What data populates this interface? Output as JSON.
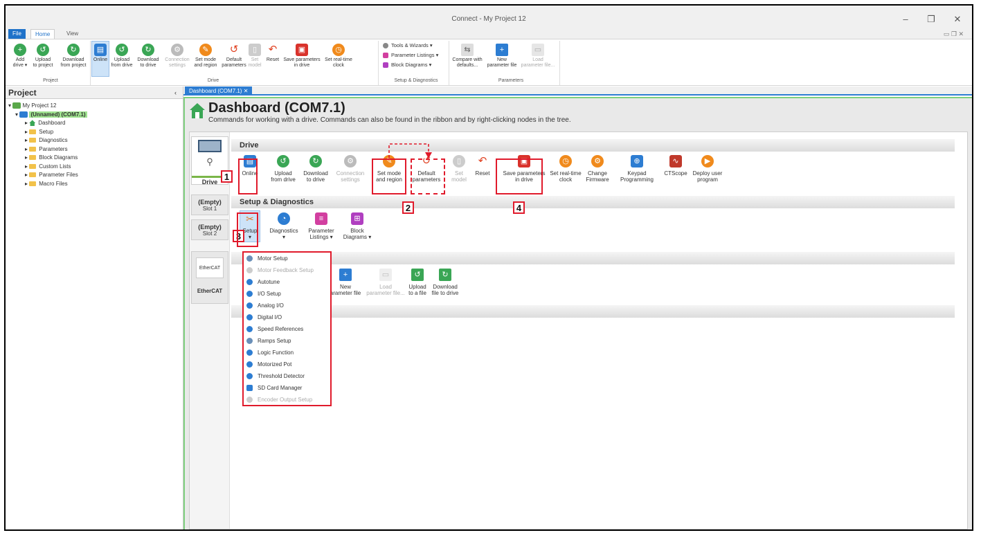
{
  "window": {
    "title": "Connect - My Project 12"
  },
  "menu_tabs": {
    "file": "File",
    "home": "Home",
    "view": "View"
  },
  "ribbon": {
    "project": {
      "add": [
        "Add",
        "drive ▾"
      ],
      "upload": [
        "Upload",
        "to project"
      ],
      "download": [
        "Download",
        "from project"
      ],
      "group": "Project"
    },
    "drive": {
      "online": [
        "Online",
        ""
      ],
      "upload": [
        "Upload",
        "from drive"
      ],
      "download": [
        "Download",
        "to drive"
      ],
      "connection": [
        "Connection",
        "settings"
      ],
      "setmode": [
        "Set mode",
        "and region"
      ],
      "default": [
        "Default",
        "parameters"
      ],
      "setmodel": [
        "Set",
        "model"
      ],
      "reset": [
        "Reset",
        ""
      ],
      "save": [
        "Save parameters",
        "in drive"
      ],
      "clock": [
        "Set real-time",
        "clock"
      ],
      "group": "Drive"
    },
    "setup_diag": {
      "tools": "Tools & Wizards",
      "listings": "Parameter Listings",
      "blocks": "Block Diagrams",
      "group": "Setup & Diagnostics"
    },
    "parameters": {
      "compare": [
        "Compare with",
        "defaults..."
      ],
      "new": [
        "New",
        "parameter file"
      ],
      "load": [
        "Load",
        "parameter file..."
      ],
      "group": "Parameters"
    }
  },
  "sidebar": {
    "header": "Project",
    "root": "My Project 12",
    "drive": "(Unnamed) (COM7.1)",
    "items": [
      "Dashboard",
      "Setup",
      "Diagnostics",
      "Parameters",
      "Block Diagrams",
      "Custom Lists",
      "Parameter Files",
      "Macro Files"
    ]
  },
  "doc_tab": "Dashboard (COM7.1)",
  "dashboard": {
    "title": "Dashboard (COM7.1)",
    "subtitle": "Commands for working with a drive. Commands can also be found in the ribbon and by right-clicking nodes in the tree.",
    "left": {
      "drive": "Drive",
      "slot1": [
        "(Empty)",
        "Slot 1"
      ],
      "slot2": [
        "(Empty)",
        "Slot 2"
      ],
      "ethercat_logo": "EtherCAT",
      "ethercat": "EtherCAT"
    },
    "section_drive": "Drive",
    "drive_buttons": [
      [
        "Online",
        ""
      ],
      [
        "Upload",
        "from drive"
      ],
      [
        "Download",
        "to drive"
      ],
      [
        "Connection",
        "settings"
      ],
      [
        "Set mode",
        "and region"
      ],
      [
        "Default",
        "parameters"
      ],
      [
        "Set",
        "model"
      ],
      [
        "Reset",
        ""
      ],
      [
        "Save parameters",
        "in drive"
      ],
      [
        "Set real-time",
        "clock"
      ],
      [
        "Change",
        "Firmware"
      ],
      [
        "Keypad",
        "Programming"
      ],
      [
        "CTScope",
        ""
      ],
      [
        "Deploy user",
        "program"
      ]
    ],
    "section_setup": "Setup & Diagnostics",
    "setup_buttons": [
      [
        "Setup",
        "▾"
      ],
      [
        "Diagnostics",
        "▾"
      ],
      [
        "Parameter",
        "Listings ▾"
      ],
      [
        "Block",
        "Diagrams ▾"
      ]
    ],
    "param_buttons": [
      [
        "New",
        "arameter file"
      ],
      [
        "Load",
        "parameter file..."
      ],
      [
        "Upload",
        "to a file"
      ],
      [
        "Download",
        "file to drive"
      ]
    ],
    "setup_menu": [
      "Motor Setup",
      "Motor Feedback Setup",
      "Autotune",
      "I/O Setup",
      "Analog I/O",
      "Digital I/O",
      "Speed References",
      "Ramps Setup",
      "Logic Function",
      "Motorized Pot",
      "Threshold Detector",
      "SD Card Manager",
      "Encoder Output Setup"
    ],
    "callouts": [
      "1",
      "2",
      "3",
      "4"
    ]
  },
  "colors": {
    "accent": "#2d7dd2",
    "green": "#3aa655",
    "orange": "#f08a1c",
    "red": "#e01a2b"
  }
}
